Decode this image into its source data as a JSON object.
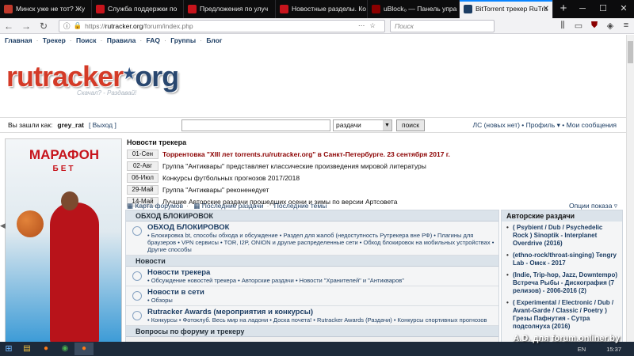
{
  "browser": {
    "tabs": [
      {
        "title": "Минск уже не тот? Жу",
        "favicon_color": "#c0392b"
      },
      {
        "title": "Служба поддержки по",
        "favicon_color": "#c7141c"
      },
      {
        "title": "Предложения по улуч",
        "favicon_color": "#c7141c"
      },
      {
        "title": "Новостные разделы. Ко",
        "favicon_color": "#c7141c"
      },
      {
        "title": "uBlock₀ — Панель упра",
        "favicon_color": "#8b0000"
      },
      {
        "title": "BitTorrent трекер RuTra",
        "favicon_color": "#1c3d63"
      }
    ],
    "new_tab": "+",
    "url_scheme": "https://",
    "url_domain": "rutracker.org",
    "url_path": "/forum/index.php",
    "search_placeholder": "Поиск"
  },
  "topmenu": [
    "Главная",
    "Трекер",
    "Поиск",
    "Правила",
    "FAQ",
    "Группы",
    "Блог"
  ],
  "logo": {
    "part1": "rutracker",
    "part2": "org",
    "slogan": "Скачал? - Раздавай!"
  },
  "login": {
    "label": "Вы зашли как:",
    "username": "grey_rat",
    "logout": "[ Выход ]",
    "search_select": "раздачи",
    "search_button": "поиск",
    "right_links": "ЛС (новых нет) • Профиль ▾ • Мои сообщения"
  },
  "ad": {
    "brand": "МАРАФОН",
    "brand2": "БЕТ"
  },
  "news": {
    "title": "Новости трекера",
    "items": [
      {
        "date": "01-Сен",
        "text": "Торрентовка \"XIII лет torrents.ru/rutracker.org\" в Санкт-Петербурге. 23 сентября 2017 г."
      },
      {
        "date": "02-Авг",
        "text": "Группа \"Антиквары\" представляет классические произведения мировой литературы"
      },
      {
        "date": "06-Июл",
        "text": "Конкурсы футбольных прогнозов 2017/2018"
      },
      {
        "date": "29-Май",
        "text": "Группа \"Антиквары\" реконенедует"
      },
      {
        "date": "14-Май",
        "text": "Лучшие Авторские раздачи прошедших осени и зимы по версии Артсовета"
      }
    ]
  },
  "forum_nav": [
    "Карта форумов",
    "Последние раздачи",
    "Последние темы"
  ],
  "options_link": "Опции показа ▿",
  "categories": [
    {
      "name": "ОБХОД БЛОКИРОВОК",
      "forums": [
        {
          "title": "ОБХОД БЛОКИРОВОК",
          "sub": "• Блокировка bt, способы обхода и обсуждение • Раздел для жалоб (недоступность Рутрекера вне РФ) • Плагины для браузеров • VPN сервисы • TOR, I2P, ONION и другие распределенные сети • Обход блокировок на мобильных устройствах • Другие способы"
        }
      ]
    },
    {
      "name": "Новости",
      "forums": [
        {
          "title": "Новости трекера",
          "sub": "• Обсуждение новостей трекера • Авторские раздачи • Новости \"Хранителей\" и \"Антикваров\""
        },
        {
          "title": "Новости в сети",
          "sub": "• Обзоры"
        },
        {
          "title": "Rutracker Awards (мероприятия и конкурсы)",
          "sub": "• Конкурсы • Фотоклуб. Весь мир на ладони • Доска почета! • Rutracker Awards (Раздачи) • Конкурсы спортивных прогнозов"
        }
      ]
    },
    {
      "name": "Вопросы по форуму и трекеру",
      "forums": []
    }
  ],
  "sidebar": {
    "title": "Авторские раздачи",
    "items": [
      "( Psybient / Dub / Psychedelic Rock ) Sinoptik - Interplanet Overdrive (2016)",
      "(ethno-rock/throat-singing) Tengry Lab - Омск - 2017",
      "(Indie, Trip-hop, Jazz, Downtempo) Встреча Рыбы - Дискография (7 релизов) - 2006-2016 (2)",
      "( Experimental / Electronic / Dub / Avant-Garde / Classic / Poetry ) Грезы Пафнутия - Сутра подсолнуха (2016)"
    ]
  },
  "taskbar": {
    "lang": "EN",
    "clock": "15:37"
  },
  "watermark": "A.D. для forum.onliner.by"
}
